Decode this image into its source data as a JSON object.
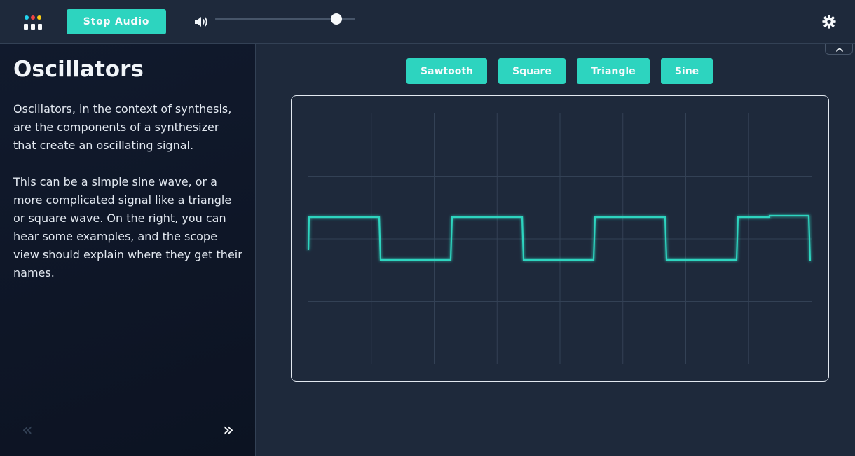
{
  "toolbar": {
    "stop_label": "Stop Audio",
    "volume_level": 0.865,
    "logo_colors": [
      "#22d3ee",
      "#ef4444",
      "#facc15"
    ]
  },
  "sidebar": {
    "title": "Oscillators",
    "paragraphs": [
      "Oscillators, in the context of synthesis, are the components of a synthesizer that create an oscillating signal.",
      "This can be a simple sine wave, or a more complicated signal like a triangle or square wave. On the right, you can hear some examples, and the scope view should explain where they get their names."
    ],
    "prev_symbol": "«",
    "next_symbol": "»"
  },
  "waveforms": [
    "Sawtooth",
    "Square",
    "Triangle",
    "Sine"
  ],
  "colors": {
    "accent": "#2dd4bf",
    "trace": "#2dd4bf",
    "grid": "#334155",
    "background": "#1e293b"
  },
  "icons": {
    "volume": "speaker-icon",
    "settings": "gear-icon",
    "collapse": "chevron-up-icon",
    "prev": "chevron-double-left-icon",
    "next": "chevron-double-right-icon"
  }
}
